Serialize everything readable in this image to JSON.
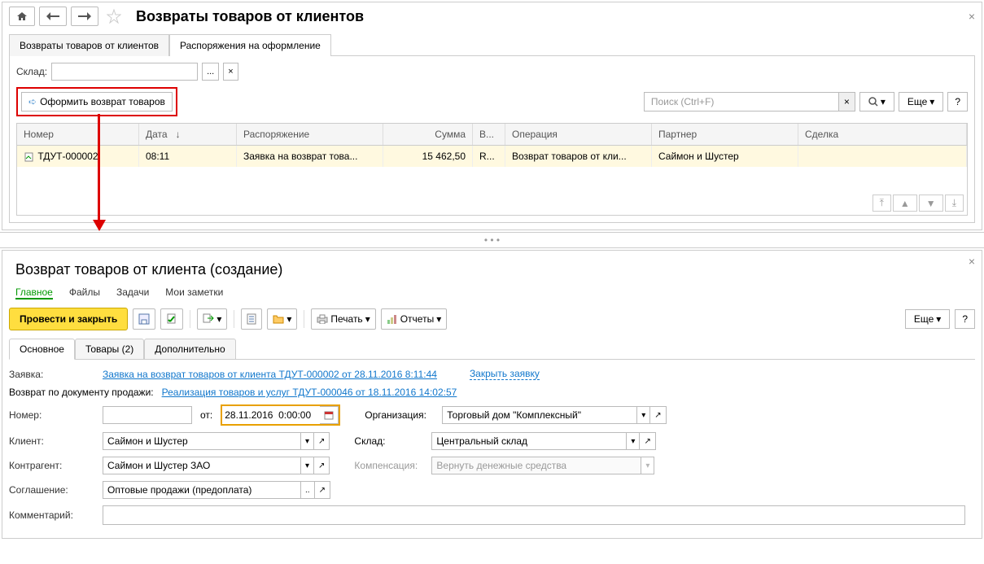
{
  "top": {
    "title": "Возвраты товаров от клиентов",
    "tab1": "Возвраты товаров от клиентов",
    "tab2": "Распоряжения на оформление",
    "sklad_label": "Склад:",
    "action_btn": "Оформить возврат товаров",
    "search_placeholder": "Поиск (Ctrl+F)",
    "more": "Еще",
    "help": "?",
    "cols": {
      "num": "Номер",
      "date": "Дата",
      "order": "Распоряжение",
      "sum": "Сумма",
      "v": "В...",
      "op": "Операция",
      "partner": "Партнер",
      "deal": "Сделка"
    },
    "row": {
      "num": "ТДУТ-000002",
      "date": "08:11",
      "order": "Заявка на возврат това...",
      "sum": "15 462,50",
      "v": "R...",
      "op": "Возврат товаров от кли...",
      "partner": "Саймон и Шустер",
      "deal": ""
    }
  },
  "bottom": {
    "title": "Возврат товаров от клиента (создание)",
    "nav": {
      "main": "Главное",
      "files": "Файлы",
      "tasks": "Задачи",
      "notes": "Мои заметки"
    },
    "post_close": "Провести и закрыть",
    "print": "Печать",
    "reports": "Отчеты",
    "more": "Еще",
    "help": "?",
    "tabs": {
      "main": "Основное",
      "goods": "Товары (2)",
      "extra": "Дополнительно"
    },
    "zayavka_label": "Заявка:",
    "zayavka_link": "Заявка на возврат товаров от клиента ТДУТ-000002 от 28.11.2016 8:11:44",
    "close_zayavka": "Закрыть заявку",
    "vozvrat_label": "Возврат по документу продажи:",
    "realizacia_link": "Реализация товаров и услуг ТДУТ-000046 от 18.11.2016 14:02:57",
    "num_label": "Номер:",
    "ot_label": "от:",
    "date_value": "28.11.2016  0:00:00",
    "org_label": "Организация:",
    "org_value": "Торговый дом \"Комплексный\"",
    "client_label": "Клиент:",
    "client_value": "Саймон и Шустер",
    "sklad_label": "Склад:",
    "sklad_value": "Центральный склад",
    "contragent_label": "Контрагент:",
    "contragent_value": "Саймон и Шустер ЗАО",
    "comp_label": "Компенсация:",
    "comp_value": "Вернуть денежные средства",
    "agreement_label": "Соглашение:",
    "agreement_value": "Оптовые продажи (предоплата)",
    "comment_label": "Комментарий:"
  }
}
